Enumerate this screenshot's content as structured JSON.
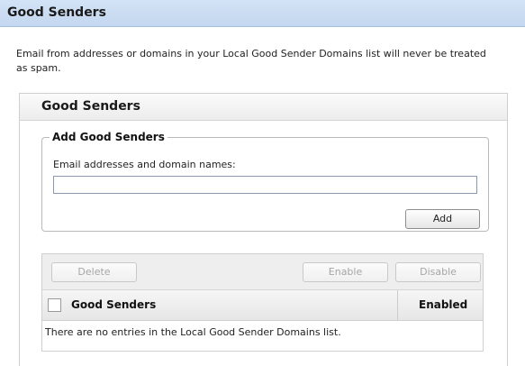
{
  "page": {
    "title": "Good Senders",
    "intro": "Email from addresses or domains in your Local Good Sender Domains list will never be treated as spam."
  },
  "panel": {
    "title": "Good Senders",
    "add_group": {
      "legend": "Add Good Senders",
      "field_label": "Email addresses and domain names:",
      "field_value": "",
      "add_button": "Add"
    },
    "toolbar": {
      "delete_button": "Delete",
      "enable_button": "Enable",
      "disable_button": "Disable"
    },
    "table": {
      "columns": [
        "Good Senders",
        "Enabled"
      ],
      "empty_message": "There are no entries in the Local Good Sender Domains list."
    }
  }
}
